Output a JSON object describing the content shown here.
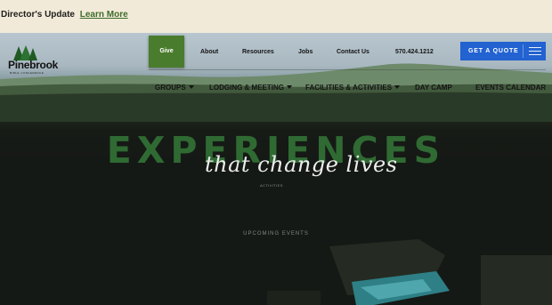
{
  "announcement": {
    "text": "Director's Update",
    "link": "Learn More"
  },
  "brand": {
    "name": "Pinebrook",
    "tagline": "BIBLE CONFERENCE"
  },
  "topnav": {
    "give": "Give",
    "about": "About",
    "resources": "Resources",
    "jobs": "Jobs",
    "contact": "Contact Us",
    "phone": "570.424.1212",
    "quote": "GET A QUOTE"
  },
  "mainnav": {
    "groups": "GROUPS",
    "lodging": "LODGING & MEETING",
    "facilities": "FACILITIES & ACTIVITIES",
    "daycamp": "DAY CAMP",
    "events": "EVENTS CALENDAR"
  },
  "hero": {
    "headline": "EXPERIENCES",
    "script": "that change lives",
    "tiny": "ACTIVITIES",
    "upcoming": "UPCOMING EVENTS"
  },
  "colors": {
    "accent_green": "#4a7c2d",
    "quote_blue": "#2262d1",
    "headline_green": "#2f6a33",
    "banner_bg": "#f2ead8"
  },
  "icons": {
    "menu": "hamburger-icon",
    "dropdown": "caret-down-icon",
    "logo": "pine-trees-logo"
  }
}
